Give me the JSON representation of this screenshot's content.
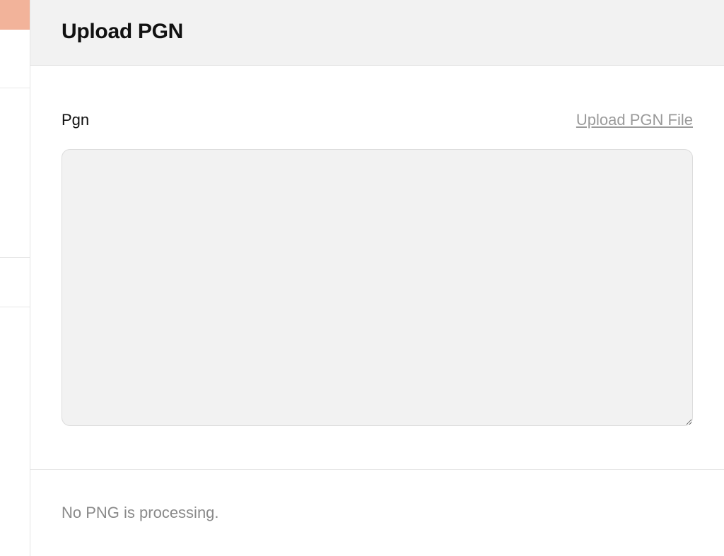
{
  "header": {
    "title": "Upload PGN"
  },
  "form": {
    "field_label": "Pgn",
    "upload_link_label": "Upload PGN File",
    "textarea_value": ""
  },
  "status": {
    "message": "No PNG is processing."
  }
}
